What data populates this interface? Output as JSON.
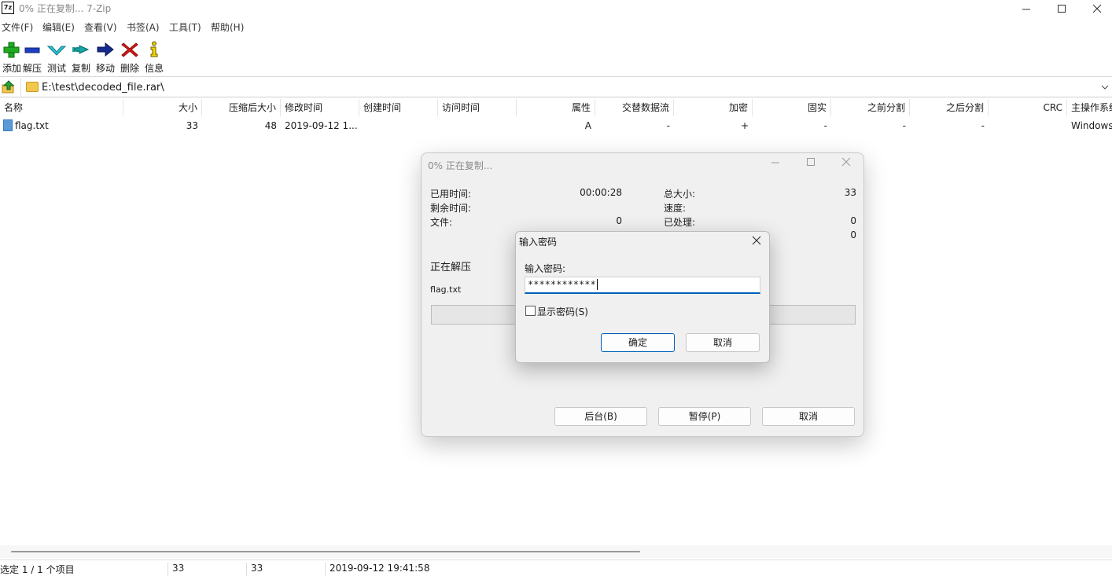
{
  "window": {
    "title": "0% 正在复制... 7-Zip",
    "icon_text": "7z"
  },
  "menu": [
    "文件(F)",
    "编辑(E)",
    "查看(V)",
    "书签(A)",
    "工具(T)",
    "帮助(H)"
  ],
  "toolbar": {
    "add": "添加",
    "extract": "解压",
    "test": "测试",
    "copy": "复制",
    "move": "移动",
    "delete": "删除",
    "info": "信息"
  },
  "address": {
    "path": "E:\\test\\decoded_file.rar\\"
  },
  "columns": {
    "name": "名称",
    "size": "大小",
    "packed": "压缩后大小",
    "modified": "修改时间",
    "created": "创建时间",
    "accessed": "访问时间",
    "attributes": "属性",
    "alt_streams": "交替数据流",
    "encrypted": "加密",
    "solid": "固实",
    "split_before": "之前分割",
    "split_after": "之后分割",
    "crc": "CRC",
    "host_os": "主操作系统"
  },
  "files": [
    {
      "name": "flag.txt",
      "size": "33",
      "packed": "48",
      "modified": "2019-09-12 1...",
      "created": "",
      "accessed": "",
      "attributes": "A",
      "alt_streams": "-",
      "encrypted": "+",
      "solid": "-",
      "split_before": "-",
      "split_after": "-",
      "crc": "",
      "host_os": "Windows"
    }
  ],
  "status": {
    "selected": "选定 1 / 1 个项目",
    "size": "33",
    "packed": "33",
    "date": "2019-09-12 19:41:58"
  },
  "progress": {
    "title": "0% 正在复制...",
    "elapsed_label": "已用时间:",
    "elapsed_value": "00:00:28",
    "remaining_label": "剩余时间:",
    "files_label": "文件:",
    "files_value": "0",
    "total_label": "总大小:",
    "total_value": "33",
    "speed_label": "速度:",
    "processed_label": "已处理:",
    "processed_value": "0",
    "compressed_value": "0",
    "action": "正在解压",
    "current_file": "flag.txt",
    "background_button": "后台(B)",
    "pause_button": "暂停(P)",
    "cancel_button": "取消",
    "progress_percent": 0
  },
  "password_dialog": {
    "title": "输入密码",
    "label": "输入密码:",
    "value": "************",
    "show_password": "显示密码(S)",
    "ok_button": "确定",
    "cancel_button": "取消"
  }
}
